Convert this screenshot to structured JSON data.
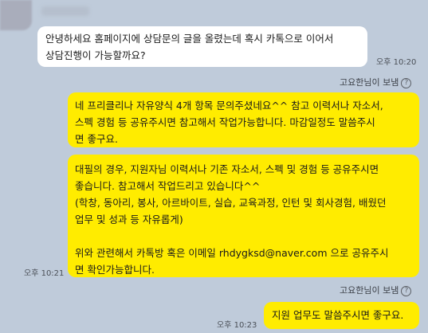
{
  "incoming": {
    "lines": [
      "안녕하세요 홈페이지에 상담문의 글을 올렸는데 혹시 카톡으로 이어서",
      "상담진행이 가능할까요?"
    ],
    "time": "오후 10:20"
  },
  "sender_label_1": "고요한님이 보냄",
  "outgoing_1": {
    "lines": [
      "네 프리클리나 자유양식 4개 항목 문의주셨네요^^ 참고 이력서나 자소서,",
      "스펙 경험 등 공유주시면 참고해서 작업가능합니다. 마감일정도 말씀주시",
      "면 좋구요."
    ]
  },
  "outgoing_2": {
    "lines": [
      "대필의 경우, 지원자님 이력서나 기존 자소서, 스펙 및 경험 등 공유주시면",
      "좋습니다. 참고해서 작업드리고 있습니다^^",
      "(학창, 동아리, 봉사, 아르바이트, 실습, 교육과정, 인턴 및 회사경험, 배웠던",
      "업무 및 성과 등 자유롭게)",
      "",
      "위와 관련해서 카톡방 혹은 이메일 rhdygksd@naver.com 으로 공유주시",
      "면 확인가능합니다."
    ],
    "time": "오후 10:21"
  },
  "sender_label_2": "고요한님이 보냄",
  "outgoing_3": {
    "lines": [
      "지원 업무도 말씀주시면 좋구요."
    ],
    "time": "오후 10:23"
  },
  "icons": {
    "help": "?"
  }
}
